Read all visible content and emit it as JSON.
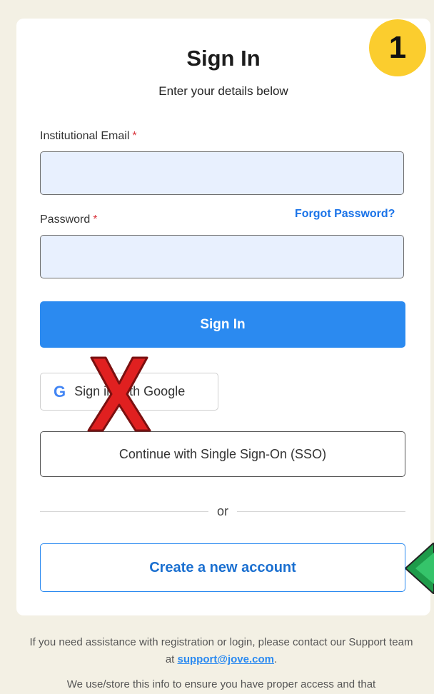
{
  "header": {
    "title": "Sign In",
    "subtitle": "Enter your details below"
  },
  "form": {
    "email_label": "Institutional Email",
    "email_value": "",
    "password_label": "Password",
    "password_value": "",
    "required_mark": "*",
    "forgot_password": "Forgot Password?",
    "submit_label": "Sign In"
  },
  "alt_signin": {
    "google_label": "Sign in with Google",
    "google_icon": "google-icon",
    "sso_label": "Continue with Single Sign-On (SSO)",
    "divider_text": "or",
    "create_account_label": "Create a new account"
  },
  "annotations": {
    "step_number": "1",
    "cross_mark": "x-mark-icon",
    "cross_color": "#e02020",
    "pointer": "green-arrow-icon",
    "pointer_color": "#1e9b4a"
  },
  "footer": {
    "help_text_1": "If you need assistance with registration or login, please contact our Support team at",
    "support_email": "support@jove.com",
    "help_text_end": ".",
    "privacy_text": "We use/store this info to ensure you have proper access and that"
  },
  "colors": {
    "primary": "#2b8af0",
    "badge": "#fbcd2e",
    "background": "#f3f0e4"
  }
}
